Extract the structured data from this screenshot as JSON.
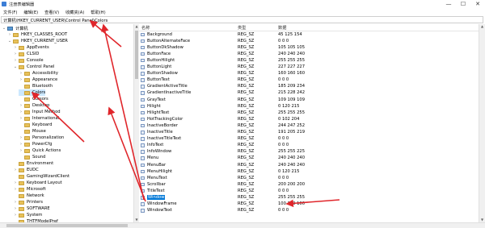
{
  "window": {
    "title": "注册表编辑器",
    "controls": [
      "—",
      "☐",
      "✕"
    ]
  },
  "menu": [
    "文件(F)",
    "编辑(E)",
    "查看(V)",
    "收藏夹(A)",
    "帮助(H)"
  ],
  "address": "计算机\\HKEY_CURRENT_USER\\Control Panel\\Colors",
  "tree": [
    {
      "label": "计算机",
      "level": 0,
      "exp": "v",
      "icon": "computer"
    },
    {
      "label": "HKEY_CLASSES_ROOT",
      "level": 1,
      "exp": ">"
    },
    {
      "label": "HKEY_CURRENT_USER",
      "level": 1,
      "exp": "v"
    },
    {
      "label": "AppEvents",
      "level": 2,
      "exp": ">"
    },
    {
      "label": "CLSID",
      "level": 2,
      "exp": ">"
    },
    {
      "label": "Console",
      "level": 2,
      "exp": ">"
    },
    {
      "label": "Control Panel",
      "level": 2,
      "exp": "v"
    },
    {
      "label": "Accessibility",
      "level": 3,
      "exp": ">"
    },
    {
      "label": "Appearance",
      "level": 3,
      "exp": ">"
    },
    {
      "label": "Bluetooth",
      "level": 3,
      "exp": ""
    },
    {
      "label": "Colors",
      "level": 3,
      "exp": "",
      "selected": true
    },
    {
      "label": "Cursors",
      "level": 3,
      "exp": ""
    },
    {
      "label": "Desktop",
      "level": 3,
      "exp": ">"
    },
    {
      "label": "Input Method",
      "level": 3,
      "exp": ">"
    },
    {
      "label": "International",
      "level": 3,
      "exp": ">"
    },
    {
      "label": "Keyboard",
      "level": 3,
      "exp": ""
    },
    {
      "label": "Mouse",
      "level": 3,
      "exp": ""
    },
    {
      "label": "Personalization",
      "level": 3,
      "exp": ">"
    },
    {
      "label": "PowerCfg",
      "level": 3,
      "exp": ">"
    },
    {
      "label": "Quick Actions",
      "level": 3,
      "exp": ">"
    },
    {
      "label": "Sound",
      "level": 3,
      "exp": ""
    },
    {
      "label": "Environment",
      "level": 2,
      "exp": ""
    },
    {
      "label": "EUDC",
      "level": 2,
      "exp": ">"
    },
    {
      "label": "GamingWizardClient",
      "level": 2,
      "exp": ""
    },
    {
      "label": "Keyboard Layout",
      "level": 2,
      "exp": ">"
    },
    {
      "label": "Microsoft",
      "level": 2,
      "exp": ">"
    },
    {
      "label": "Network",
      "level": 2,
      "exp": ""
    },
    {
      "label": "Printers",
      "level": 2,
      "exp": ">"
    },
    {
      "label": "SOFTWARE",
      "level": 2,
      "exp": ">"
    },
    {
      "label": "System",
      "level": 2,
      "exp": ">"
    },
    {
      "label": "THTFModelPref",
      "level": 2,
      "exp": ""
    }
  ],
  "columns": {
    "name": "名称",
    "type": "类型",
    "data": "数据"
  },
  "values": [
    {
      "name": "Background",
      "type": "REG_SZ",
      "data": "45 125 154"
    },
    {
      "name": "ButtonAlternateFace",
      "type": "REG_SZ",
      "data": "0 0 0"
    },
    {
      "name": "ButtonDkShadow",
      "type": "REG_SZ",
      "data": "105 105 105"
    },
    {
      "name": "ButtonFace",
      "type": "REG_SZ",
      "data": "240 240 240"
    },
    {
      "name": "ButtonHilight",
      "type": "REG_SZ",
      "data": "255 255 255"
    },
    {
      "name": "ButtonLight",
      "type": "REG_SZ",
      "data": "227 227 227"
    },
    {
      "name": "ButtonShadow",
      "type": "REG_SZ",
      "data": "160 160 160"
    },
    {
      "name": "ButtonText",
      "type": "REG_SZ",
      "data": "0 0 0"
    },
    {
      "name": "GradientActiveTitle",
      "type": "REG_SZ",
      "data": "185 209 234"
    },
    {
      "name": "GradientInactiveTitle",
      "type": "REG_SZ",
      "data": "215 228 242"
    },
    {
      "name": "GrayText",
      "type": "REG_SZ",
      "data": "109 109 109"
    },
    {
      "name": "Hilight",
      "type": "REG_SZ",
      "data": "0 120 215"
    },
    {
      "name": "HilightText",
      "type": "REG_SZ",
      "data": "255 255 255"
    },
    {
      "name": "HotTrackingColor",
      "type": "REG_SZ",
      "data": "0 102 204"
    },
    {
      "name": "InactiveBorder",
      "type": "REG_SZ",
      "data": "244 247 252"
    },
    {
      "name": "InactiveTitle",
      "type": "REG_SZ",
      "data": "191 205 219"
    },
    {
      "name": "InactiveTitleText",
      "type": "REG_SZ",
      "data": "0 0 0"
    },
    {
      "name": "InfoText",
      "type": "REG_SZ",
      "data": "0 0 0"
    },
    {
      "name": "InfoWindow",
      "type": "REG_SZ",
      "data": "255 255 225"
    },
    {
      "name": "Menu",
      "type": "REG_SZ",
      "data": "240 240 240"
    },
    {
      "name": "MenuBar",
      "type": "REG_SZ",
      "data": "240 240 240"
    },
    {
      "name": "MenuHilight",
      "type": "REG_SZ",
      "data": "0 120 215"
    },
    {
      "name": "MenuText",
      "type": "REG_SZ",
      "data": "0 0 0"
    },
    {
      "name": "Scrollbar",
      "type": "REG_SZ",
      "data": "200 200 200"
    },
    {
      "name": "TitleText",
      "type": "REG_SZ",
      "data": "0 0 0"
    },
    {
      "name": "Window",
      "type": "REG_SZ",
      "data": "255 255 255",
      "selected": true
    },
    {
      "name": "WindowFrame",
      "type": "REG_SZ",
      "data": "100 100 100"
    },
    {
      "name": "WindowText",
      "type": "REG_SZ",
      "data": "0 0 0"
    }
  ],
  "colors": {
    "selection": "#0078d7",
    "tree_selection": "#cce8ff",
    "annotation": "#e0262b"
  }
}
